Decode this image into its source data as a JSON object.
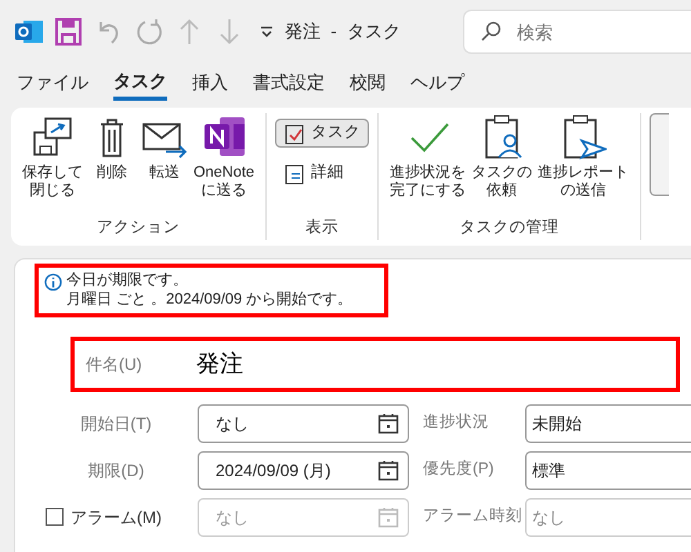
{
  "title_bar": {
    "title": "発注  -  タスク",
    "search": {
      "placeholder": "検索"
    }
  },
  "tabs": [
    {
      "label": "ファイル",
      "selected": false
    },
    {
      "label": "タスク",
      "selected": true
    },
    {
      "label": "挿入",
      "selected": false
    },
    {
      "label": "書式設定",
      "selected": false
    },
    {
      "label": "校閲",
      "selected": false
    },
    {
      "label": "ヘルプ",
      "selected": false
    }
  ],
  "ribbon": [
    {
      "name": "アクション",
      "buttons": [
        {
          "kind": "save-close",
          "label": [
            "保存して",
            "閉じる"
          ]
        },
        {
          "kind": "delete",
          "label": [
            "削除"
          ]
        },
        {
          "kind": "forward",
          "label": [
            "転送"
          ]
        },
        {
          "kind": "onenote",
          "label": [
            "OneNote",
            "に送る"
          ]
        }
      ]
    },
    {
      "name": "表示",
      "small_buttons": [
        {
          "kind": "task",
          "label": "タスク",
          "selected": true
        },
        {
          "kind": "details",
          "label": "詳細",
          "selected": false
        }
      ]
    },
    {
      "name": "タスクの管理",
      "buttons": [
        {
          "kind": "complete",
          "label": [
            "進捗状況を",
            "完了にする"
          ]
        },
        {
          "kind": "assign",
          "label": [
            "タスクの",
            "依頼"
          ]
        },
        {
          "kind": "report",
          "label": [
            "進捗レポート",
            "の送信"
          ]
        }
      ]
    }
  ],
  "info": {
    "lines": [
      "今日が期限です。",
      "月曜日 ごと 。2024/09/09 から開始です。"
    ]
  },
  "subject": {
    "label": "件名(U)",
    "value": "発注"
  },
  "fields": [
    {
      "label": "開始日(T)",
      "value": "なし",
      "disabled": false,
      "right_label": "進捗状況",
      "right_value": "未開始"
    },
    {
      "label": "期限(D)",
      "value": "2024/09/09 (月)",
      "disabled": false,
      "right_label": "優先度(P)",
      "right_value": "標準"
    },
    {
      "label": "アラーム(M)",
      "checked": false,
      "value": "なし",
      "disabled": true,
      "right_label": "アラーム時刻",
      "right_value": "なし"
    }
  ]
}
